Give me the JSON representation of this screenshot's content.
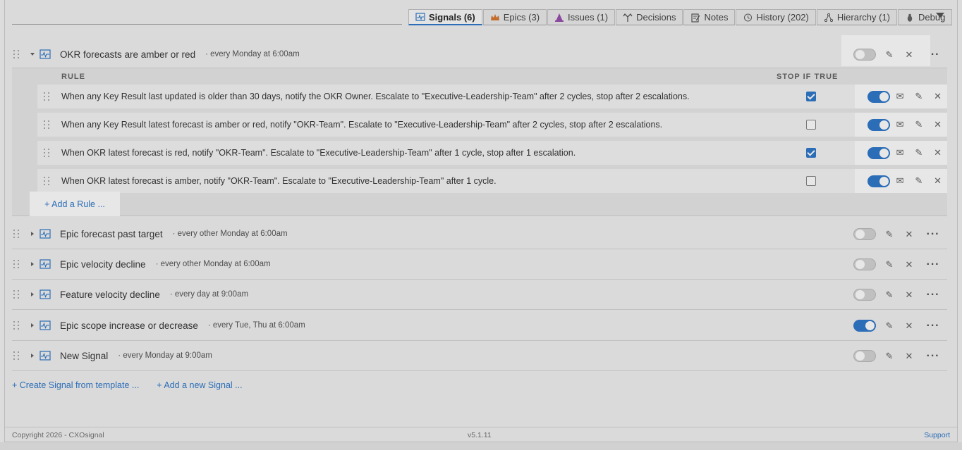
{
  "tabs": [
    {
      "label": "Signals (6)",
      "icon": "signal-icon",
      "active": true
    },
    {
      "label": "Epics (3)",
      "icon": "crown-icon",
      "active": false
    },
    {
      "label": "Issues (1)",
      "icon": "cone-icon",
      "active": false
    },
    {
      "label": "Decisions",
      "icon": "fork-icon",
      "active": false
    },
    {
      "label": "Notes",
      "icon": "note-icon",
      "active": false
    },
    {
      "label": "History (202)",
      "icon": "history-icon",
      "active": false
    },
    {
      "label": "Hierarchy (1)",
      "icon": "hierarchy-icon",
      "active": false
    },
    {
      "label": "Debug",
      "icon": "bug-icon",
      "active": false
    }
  ],
  "signals": [
    {
      "title": "OKR forecasts are amber or red",
      "schedule": "· every Monday at 6:00am",
      "enabled": false,
      "expanded": true
    },
    {
      "title": "Epic forecast past target",
      "schedule": "· every other Monday at 6:00am",
      "enabled": false,
      "expanded": false
    },
    {
      "title": "Epic velocity decline",
      "schedule": "· every other Monday at 6:00am",
      "enabled": false,
      "expanded": false
    },
    {
      "title": "Feature velocity decline",
      "schedule": "· every day at 9:00am",
      "enabled": false,
      "expanded": false
    },
    {
      "title": "Epic scope increase or decrease",
      "schedule": "· every Tue, Thu at 6:00am",
      "enabled": true,
      "expanded": false
    },
    {
      "title": "New Signal",
      "schedule": "· every Monday at 9:00am",
      "enabled": false,
      "expanded": false
    }
  ],
  "rules_panel": {
    "rule_header": "RULE",
    "stop_header": "STOP IF TRUE",
    "rules": [
      {
        "text": "When any Key Result last updated is older than 30 days, notify the OKR Owner. Escalate to \"Executive-Leadership-Team\" after 2 cycles, stop after 2 escalations.",
        "stop_if_true": true,
        "enabled": true
      },
      {
        "text": "When any Key Result latest forecast is amber or red, notify \"OKR-Team\". Escalate to \"Executive-Leadership-Team\" after 2 cycles, stop after 2 escalations.",
        "stop_if_true": false,
        "enabled": true
      },
      {
        "text": "When OKR latest forecast is red, notify \"OKR-Team\". Escalate to \"Executive-Leadership-Team\" after 1 cycle, stop after 1 escalation.",
        "stop_if_true": true,
        "enabled": true
      },
      {
        "text": "When OKR latest forecast is amber, notify \"OKR-Team\". Escalate to \"Executive-Leadership-Team\" after 1 cycle.",
        "stop_if_true": false,
        "enabled": true
      }
    ],
    "add_rule_label": "+ Add a Rule ..."
  },
  "bottom_links": {
    "create_from_template": "+ Create Signal from template ...",
    "add_new_signal": "+ Add a new Signal ..."
  },
  "footer": {
    "copyright": "Copyright 2026 - CXOsignal",
    "version": "v5.1.11",
    "support": "Support"
  },
  "colors": {
    "accent": "#1a6bc4",
    "toggle_off": "#d0d0d0"
  }
}
